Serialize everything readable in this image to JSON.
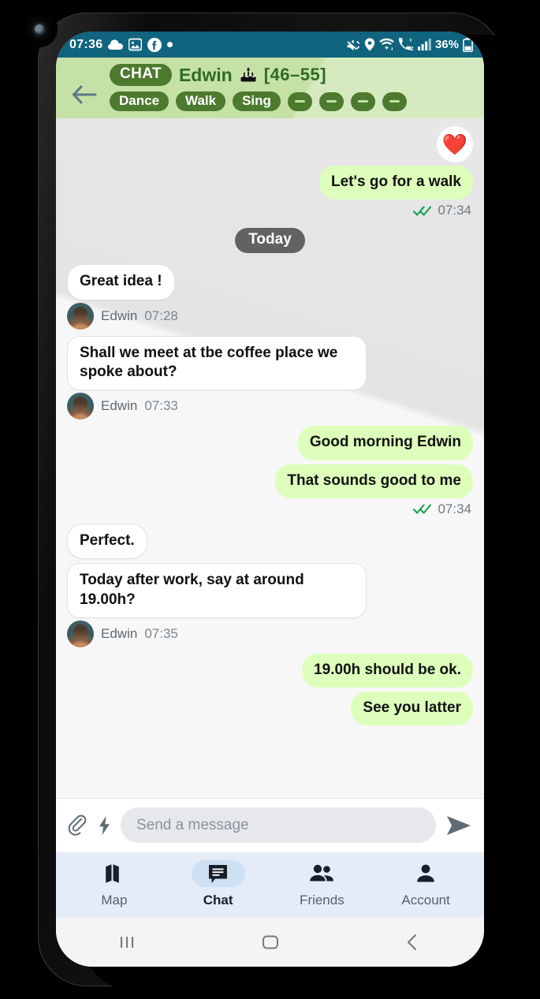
{
  "status_bar": {
    "time": "07:36",
    "battery_percent": "36%",
    "left_icons": [
      "cloud-icon",
      "gallery-icon",
      "facebook-icon",
      "dot-icon"
    ],
    "right_icons": [
      "mute-icon",
      "location-icon",
      "wifi-icon",
      "dual-sim-call-icon",
      "signal-bars-icon",
      "battery-icon"
    ],
    "background_color": "#10647e"
  },
  "header": {
    "back_icon": "back-arrow-icon",
    "chat_tag": "CHAT",
    "peer_name": "Edwin",
    "birthday_icon": "cake-icon",
    "age_range": "[46–55]",
    "actions": [
      {
        "label": "Dance"
      },
      {
        "label": "Walk"
      },
      {
        "label": "Sing"
      },
      {
        "label": ""
      },
      {
        "label": ""
      },
      {
        "label": ""
      },
      {
        "label": ""
      }
    ],
    "background_color": "#c5e1a5",
    "pill_color": "#4c7a2e"
  },
  "conversation": {
    "reaction": "❤️",
    "day_divider": "Today",
    "messages": [
      {
        "direction": "out",
        "text": "Let's go for a walk",
        "time": "07:34",
        "status": "read"
      },
      {
        "direction": "in",
        "text": "Great idea !",
        "sender": "Edwin",
        "time": "07:28"
      },
      {
        "direction": "in",
        "text": "Shall we meet at tbe coffee place we spoke about?",
        "sender": "Edwin",
        "time": "07:33"
      },
      {
        "direction": "out",
        "text": "Good morning Edwin"
      },
      {
        "direction": "out",
        "text": "That sounds good to me",
        "time": "07:34",
        "status": "read"
      },
      {
        "direction": "in",
        "text": "Perfect."
      },
      {
        "direction": "in",
        "text": "Today after work, say at around 19.00h?",
        "sender": "Edwin",
        "time": "07:35"
      },
      {
        "direction": "out",
        "text": "19.00h should be ok."
      },
      {
        "direction": "out",
        "text": "See you latter"
      }
    ],
    "out_bubble_color": "#ddffbb",
    "in_bubble_color": "#ffffff",
    "tick_color": "#12a150"
  },
  "composer": {
    "attach_icon": "paperclip-icon",
    "flash_icon": "lightning-bolt-icon",
    "placeholder": "Send a message",
    "value": "",
    "send_icon": "send-icon"
  },
  "bottom_nav": {
    "items": [
      {
        "label": "Map",
        "icon": "map-icon",
        "active": false
      },
      {
        "label": "Chat",
        "icon": "chat-bubble-icon",
        "active": true
      },
      {
        "label": "Friends",
        "icon": "people-icon",
        "active": false
      },
      {
        "label": "Account",
        "icon": "person-icon",
        "active": false
      }
    ],
    "background_color": "#e3ecf7",
    "active_pill_color": "#cfe0f3"
  },
  "system_nav": {
    "recents_icon": "recents-icon",
    "home_icon": "home-icon",
    "back_icon": "system-back-icon"
  }
}
